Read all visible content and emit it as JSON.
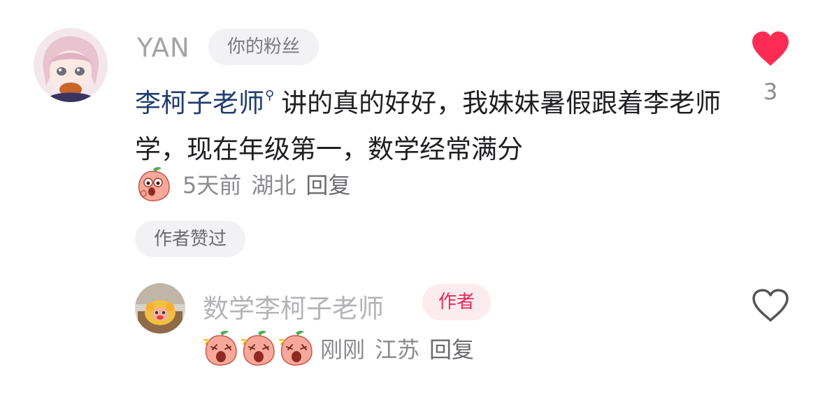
{
  "comment": {
    "username": "YAN",
    "fan_badge": "你的粉丝",
    "mention": "李柯子老师",
    "text": "讲的真的好好，我妹妹暑假跟着李老师学，现在年级第一，数学经常满分",
    "time": "5天前",
    "location": "湖北",
    "reply_label": "回复",
    "like_count": "3",
    "liked": true,
    "author_liked_badge": "作者赞过"
  },
  "reply": {
    "username": "数学李柯子老师",
    "author_badge": "作者",
    "time": "刚刚",
    "location": "江苏",
    "reply_label": "回复",
    "liked": false,
    "emoji_count": 3
  },
  "colors": {
    "heart_filled": "#fe2c55",
    "author_badge_text": "#e8285a",
    "mention": "#1f3d6e"
  },
  "icons": {
    "like_active": "heart-filled-icon",
    "like_inactive": "heart-outline-icon",
    "mention_marker": "search-icon",
    "emoji": "peach-face-emoji"
  }
}
